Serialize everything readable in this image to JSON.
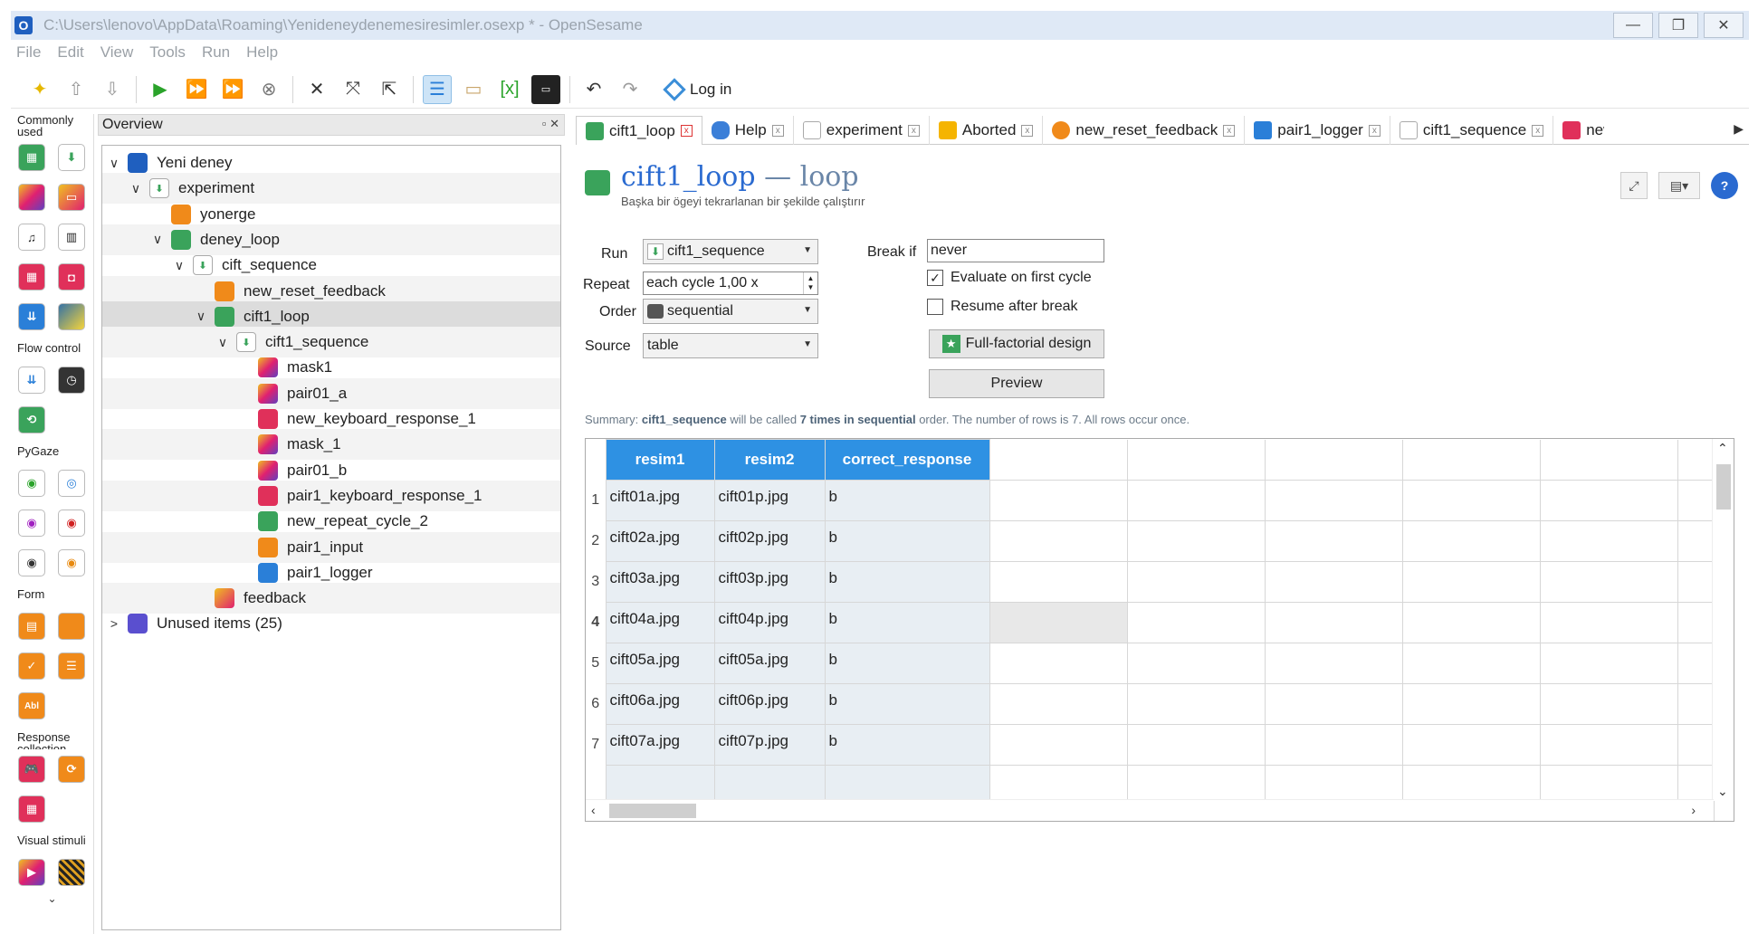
{
  "window": {
    "title": "C:\\Users\\lenovo\\AppData\\Roaming\\Yenideneydenemesiresimler.osexp * - OpenSesame",
    "minimize": "—",
    "restore": "❐",
    "close": "✕"
  },
  "menu": [
    "File",
    "Edit",
    "View",
    "Tools",
    "Run",
    "Help"
  ],
  "toolbar": {
    "login_label": "Log in"
  },
  "palette": {
    "sections": [
      "Commonly used",
      "Flow control",
      "PyGaze",
      "Form",
      "Response collection",
      "Visual stimuli"
    ]
  },
  "overview": {
    "title": "Overview",
    "controls": "▫ ✕",
    "items": [
      {
        "label": "Yeni deney",
        "depth": 0,
        "caret": "∨"
      },
      {
        "label": "experiment",
        "depth": 1,
        "caret": "∨"
      },
      {
        "label": "yonerge",
        "depth": 2,
        "caret": ""
      },
      {
        "label": "deney_loop",
        "depth": 2,
        "caret": "∨"
      },
      {
        "label": "cift_sequence",
        "depth": 3,
        "caret": "∨"
      },
      {
        "label": "new_reset_feedback",
        "depth": 4,
        "caret": ""
      },
      {
        "label": "cift1_loop",
        "depth": 4,
        "caret": "∨"
      },
      {
        "label": "cift1_sequence",
        "depth": 5,
        "caret": "∨"
      },
      {
        "label": "mask1",
        "depth": 6,
        "caret": ""
      },
      {
        "label": "pair01_a",
        "depth": 6,
        "caret": ""
      },
      {
        "label": "new_keyboard_response_1",
        "depth": 6,
        "caret": ""
      },
      {
        "label": "mask_1",
        "depth": 6,
        "caret": ""
      },
      {
        "label": "pair01_b",
        "depth": 6,
        "caret": ""
      },
      {
        "label": "pair1_keyboard_response_1",
        "depth": 6,
        "caret": ""
      },
      {
        "label": "new_repeat_cycle_2",
        "depth": 6,
        "caret": ""
      },
      {
        "label": "pair1_input",
        "depth": 6,
        "caret": ""
      },
      {
        "label": "pair1_logger",
        "depth": 6,
        "caret": ""
      },
      {
        "label": "feedback",
        "depth": 4,
        "caret": ""
      },
      {
        "label": "Unused items (25)",
        "depth": 0,
        "caret": ">"
      }
    ]
  },
  "tabs": [
    "cift1_loop",
    "Help",
    "experiment",
    "Aborted",
    "new_reset_feedback",
    "pair1_logger",
    "cift1_sequence",
    "new_"
  ],
  "header": {
    "name": "cift1_loop",
    "type": " — loop",
    "subtitle": "Başka bir ögeyi tekrarlanan bir şekilde çalıştırır"
  },
  "form": {
    "run_label": "Run",
    "run_value": "cift1_sequence",
    "repeat_label": "Repeat",
    "repeat_value": "each cycle 1,00 x",
    "order_label": "Order",
    "order_value": "sequential",
    "source_label": "Source",
    "source_value": "table",
    "break_if_label": "Break if",
    "break_if_value": "never",
    "eval_first_label": "Evaluate on first cycle",
    "eval_first_checked": "✓",
    "resume_label": "Resume after break",
    "full_factorial_label": "Full-factorial design",
    "preview_label": "Preview"
  },
  "summary": {
    "prefix": "Summary: ",
    "item": "cift1_sequence",
    "mid": " will be called ",
    "times": "7 times in sequential",
    "suffix": " order. The number of rows is 7. All rows occur once."
  },
  "table": {
    "columns": [
      "resim1",
      "resim2",
      "correct_response"
    ],
    "rows": [
      [
        "cift01a.jpg",
        "cift01p.jpg",
        "b"
      ],
      [
        "cift02a.jpg",
        "cift02p.jpg",
        "b"
      ],
      [
        "cift03a.jpg",
        "cift03p.jpg",
        "b"
      ],
      [
        "cift04a.jpg",
        "cift04p.jpg",
        "b"
      ],
      [
        "cift05a.jpg",
        "cift05a.jpg",
        "b"
      ],
      [
        "cift06a.jpg",
        "cift06p.jpg",
        "b"
      ],
      [
        "cift07a.jpg",
        "cift07p.jpg",
        "b"
      ]
    ],
    "row_numbers": [
      "1",
      "2",
      "3",
      "4",
      "5",
      "6",
      "7"
    ]
  }
}
